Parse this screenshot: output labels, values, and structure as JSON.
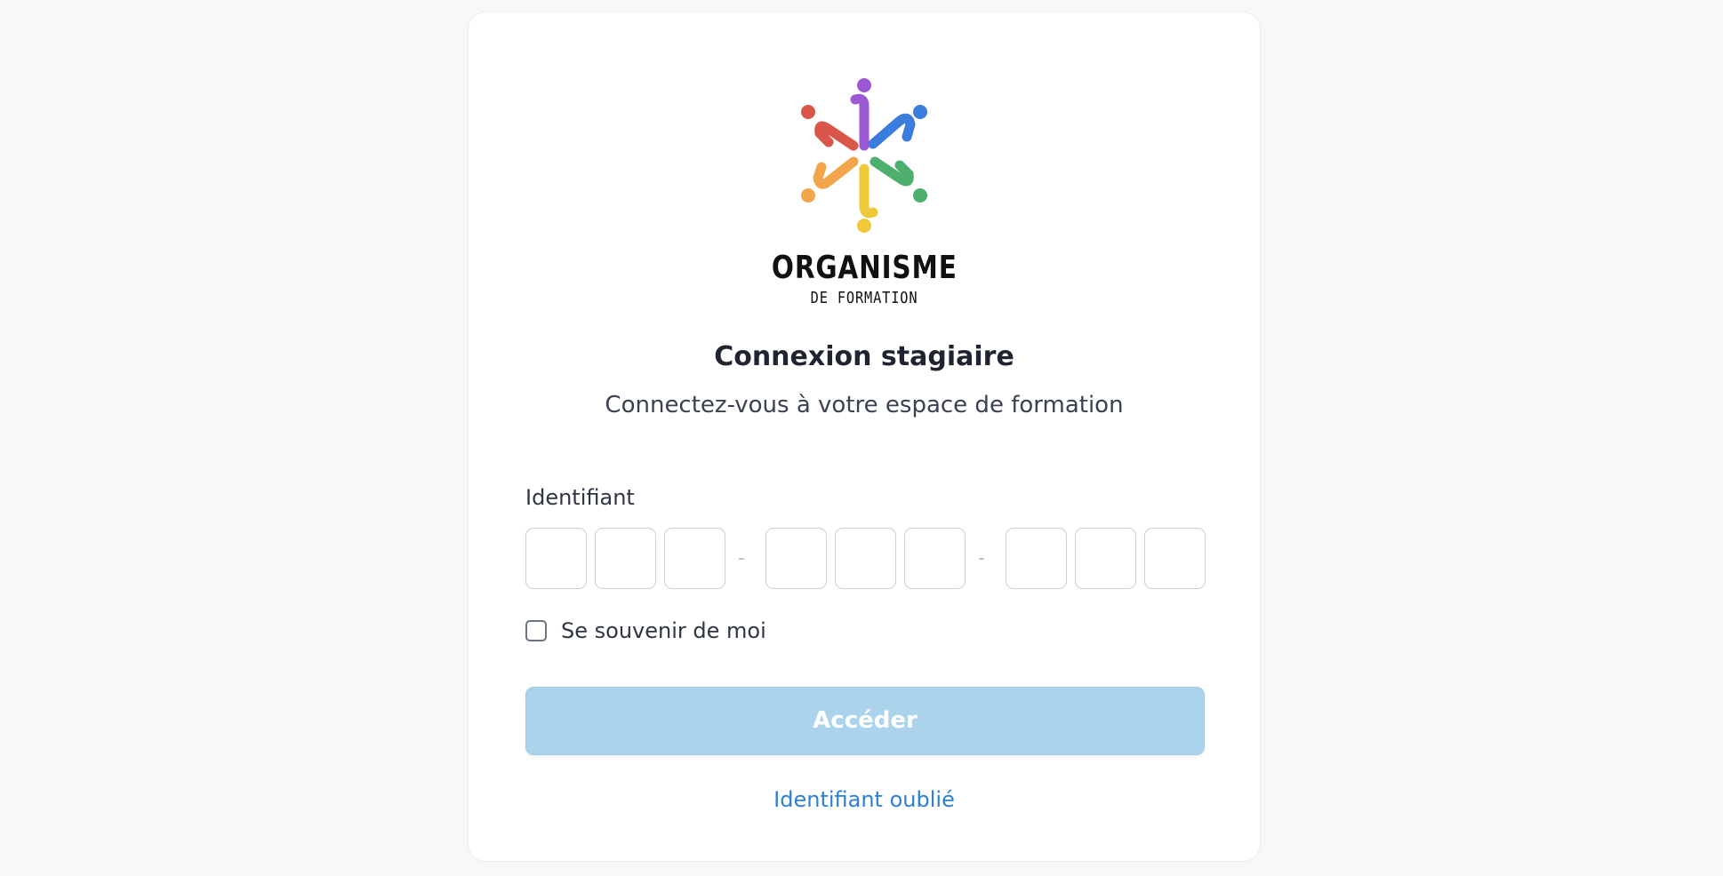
{
  "brand": {
    "name": "ORGANISME",
    "tagline": "DE FORMATION",
    "logo_colors": [
      "#9b59d6",
      "#3b7ddd",
      "#4caf6e",
      "#f0c93a",
      "#f2a54a",
      "#d9574a"
    ]
  },
  "login": {
    "title": "Connexion stagiaire",
    "subtitle": "Connectez-vous à votre espace de formation",
    "identifier_label": "Identifiant",
    "separator": "-",
    "code_groups": [
      [
        "",
        "",
        ""
      ],
      [
        "",
        "",
        ""
      ],
      [
        "",
        "",
        ""
      ]
    ],
    "remember_label": "Se souvenir de moi",
    "remember_checked": false,
    "submit_label": "Accéder",
    "submit_enabled": false,
    "forgot_link": "Identifiant oublié"
  },
  "colors": {
    "background": "#f7f8fa",
    "button_disabled": "#acd3ec",
    "link": "#2d7fd3"
  }
}
